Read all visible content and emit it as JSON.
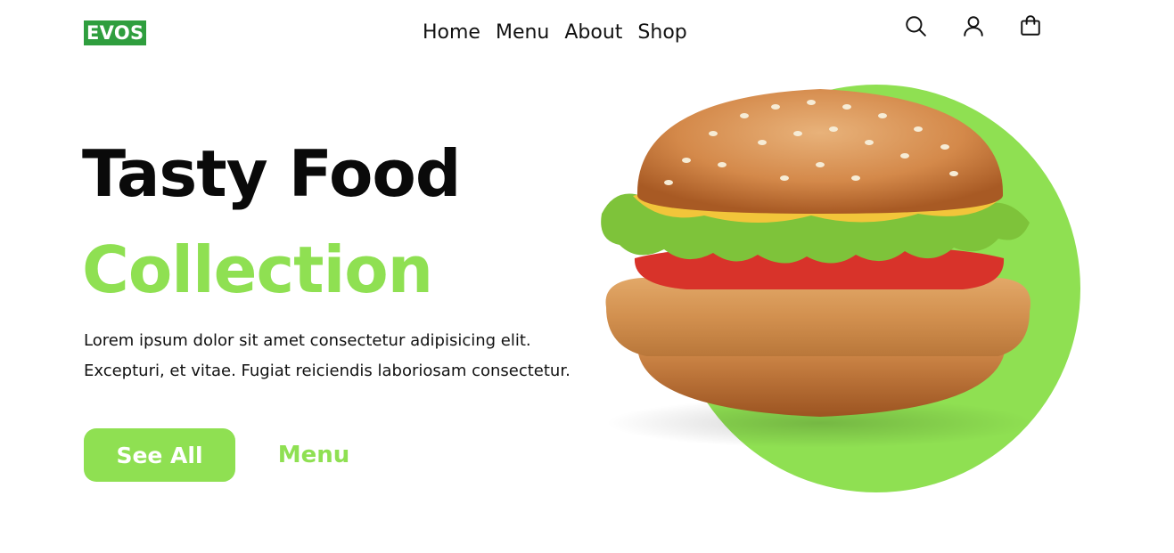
{
  "brand": {
    "logo_text": "EVOS",
    "logo_color": "#2f9e3e"
  },
  "nav": {
    "items": [
      {
        "label": "Home"
      },
      {
        "label": "Menu"
      },
      {
        "label": "About"
      },
      {
        "label": "Shop"
      }
    ]
  },
  "header_icons": [
    "search-icon",
    "user-icon",
    "shopping-bag-icon"
  ],
  "hero": {
    "title_line1": "Tasty Food",
    "title_line2": "Collection",
    "description": "Lorem ipsum dolor sit amet consectetur adipisicing elit. Excepturi, et vitae. Fugiat reiciendis laboriosam consectetur.",
    "primary_button": "See All",
    "secondary_button": "Menu",
    "image": "burger-image"
  },
  "colors": {
    "accent": "#8fe052",
    "text": "#111111",
    "background": "#ffffff"
  }
}
